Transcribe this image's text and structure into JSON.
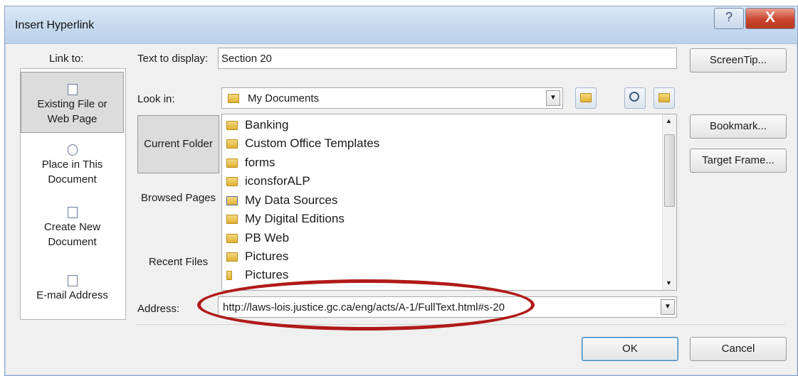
{
  "dialog": {
    "title": "Insert Hyperlink",
    "help_glyph": "?",
    "close_glyph": "X"
  },
  "link_to": {
    "label": "Link to:",
    "items": [
      {
        "line1": "Existing File or",
        "line2": "Web Page",
        "icon": "web-page-icon",
        "selected": true
      },
      {
        "line1": "Place in This",
        "line2": "Document",
        "icon": "document-place-icon",
        "selected": false
      },
      {
        "line1": "Create New",
        "line2": "Document",
        "icon": "new-document-icon",
        "selected": false
      },
      {
        "line1": "E-mail Address",
        "line2": "",
        "icon": "email-icon",
        "selected": false
      }
    ]
  },
  "text_to_display": {
    "label": "Text to display:",
    "value": "Section 20"
  },
  "screentip_button": "ScreenTip...",
  "look_in": {
    "label": "Look in:",
    "value": "My Documents"
  },
  "browse_tabs": [
    {
      "label": "Current Folder",
      "selected": true
    },
    {
      "label": "Browsed Pages",
      "selected": false
    },
    {
      "label": "Recent Files",
      "selected": false
    }
  ],
  "files": [
    {
      "name": "Banking",
      "icon": "folder-icon"
    },
    {
      "name": "Custom Office Templates",
      "icon": "folder-icon"
    },
    {
      "name": "forms",
      "icon": "folder-icon"
    },
    {
      "name": "iconsforALP",
      "icon": "folder-icon"
    },
    {
      "name": "My Data Sources",
      "icon": "data-sources-folder-icon"
    },
    {
      "name": "My Digital Editions",
      "icon": "folder-icon"
    },
    {
      "name": "PB Web",
      "icon": "folder-icon"
    },
    {
      "name": "Pictures",
      "icon": "folder-icon"
    },
    {
      "name": "Pictures",
      "icon": "pictures-shortcut-icon"
    }
  ],
  "bookmark_button": "Bookmark...",
  "target_frame_button": "Target Frame...",
  "address": {
    "label": "Address:",
    "value": "http://laws-lois.justice.gc.ca/eng/acts/A-1/FullText.html#s-20"
  },
  "ok_button": "OK",
  "cancel_button": "Cancel",
  "annotation_color": "#b01a18"
}
